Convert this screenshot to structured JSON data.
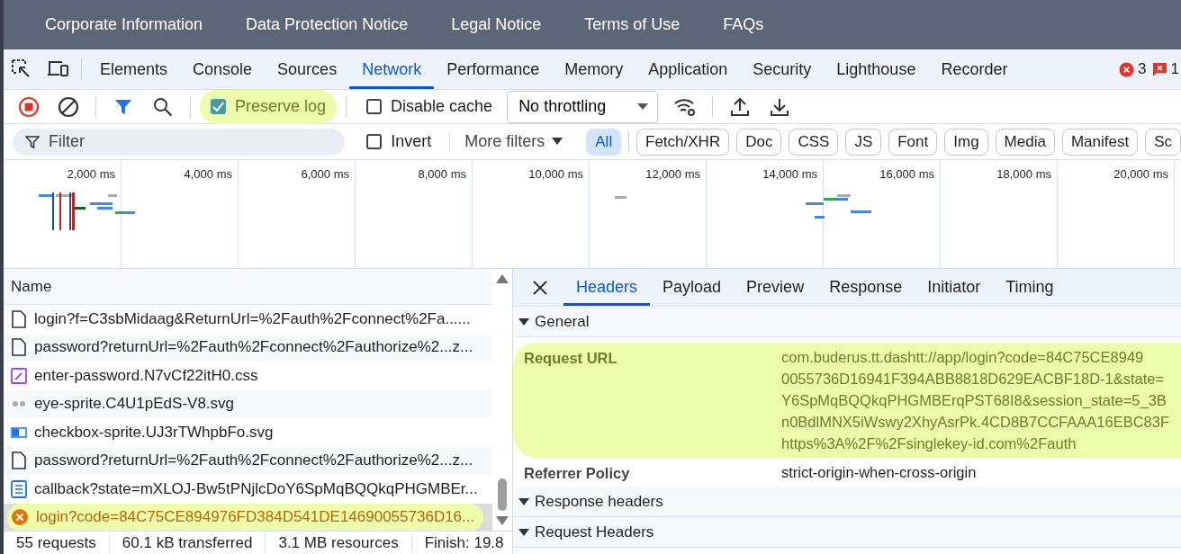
{
  "site_nav": [
    {
      "label": "Corporate Information"
    },
    {
      "label": "Data Protection Notice"
    },
    {
      "label": "Legal Notice"
    },
    {
      "label": "Terms of Use"
    },
    {
      "label": "FAQs"
    }
  ],
  "devtools_tabs": [
    {
      "label": "Elements",
      "selected": false
    },
    {
      "label": "Console",
      "selected": false
    },
    {
      "label": "Sources",
      "selected": false
    },
    {
      "label": "Network",
      "selected": true
    },
    {
      "label": "Performance",
      "selected": false
    },
    {
      "label": "Memory",
      "selected": false
    },
    {
      "label": "Application",
      "selected": false
    },
    {
      "label": "Security",
      "selected": false
    },
    {
      "label": "Lighthouse",
      "selected": false
    },
    {
      "label": "Recorder",
      "selected": false
    }
  ],
  "issue_counts": [
    {
      "kind": "error",
      "count": "3"
    },
    {
      "kind": "warning",
      "count": "1"
    }
  ],
  "toolbar": {
    "recording": true,
    "preserve_log": {
      "label": "Preserve log",
      "checked": true,
      "highlighted": true
    },
    "disable_cache": {
      "label": "Disable cache",
      "checked": false
    },
    "throttling": "No throttling"
  },
  "filter_bar": {
    "placeholder": "Filter",
    "invert": {
      "label": "Invert",
      "checked": false
    },
    "more_filters": "More filters",
    "chips": [
      {
        "label": "All",
        "selected": true
      },
      {
        "label": "Fetch/XHR",
        "selected": false
      },
      {
        "label": "Doc",
        "selected": false
      },
      {
        "label": "CSS",
        "selected": false
      },
      {
        "label": "JS",
        "selected": false
      },
      {
        "label": "Font",
        "selected": false
      },
      {
        "label": "Img",
        "selected": false
      },
      {
        "label": "Media",
        "selected": false
      },
      {
        "label": "Manifest",
        "selected": false
      },
      {
        "label": "Sc",
        "selected": false
      }
    ]
  },
  "timeline": {
    "ticks": [
      "2,000 ms",
      "4,000 ms",
      "6,000 ms",
      "8,000 ms",
      "10,000 ms",
      "12,000 ms",
      "14,000 ms",
      "16,000 ms",
      "18,000 ms",
      "20,000 ms"
    ]
  },
  "requests": {
    "column": "Name",
    "rows": [
      {
        "kind": "doc",
        "name": "login?f=C3sbMidaag&ReturnUrl=%2Fauth%2Fconnect%2Fa......",
        "selected": false,
        "highlighted": false
      },
      {
        "kind": "doc",
        "name": "password?returnUrl=%2Fauth%2Fconnect%2Fauthorize%2...z...",
        "selected": false,
        "highlighted": false
      },
      {
        "kind": "css",
        "name": "enter-password.N7vCf22itH0.css",
        "selected": false,
        "highlighted": false
      },
      {
        "kind": "sprite",
        "name": "eye-sprite.C4U1pEdS-V8.svg",
        "selected": false,
        "highlighted": false
      },
      {
        "kind": "image",
        "name": "checkbox-sprite.UJ3rTWhpbFo.svg",
        "selected": false,
        "highlighted": false
      },
      {
        "kind": "doc",
        "name": "password?returnUrl=%2Fauth%2Fconnect%2Fauthorize%2...z...",
        "selected": false,
        "highlighted": false
      },
      {
        "kind": "script",
        "name": "callback?state=mXLOJ-Bw5tPNjlcDoY6SpMqBQQkqPHGMBEr...",
        "selected": false,
        "highlighted": false
      },
      {
        "kind": "error",
        "name": "login?code=84C75CE894976FD384D541DE14690055736D16...",
        "selected": true,
        "highlighted": true
      }
    ]
  },
  "status_bar": [
    "55 requests",
    "60.1 kB transferred",
    "3.1 MB resources",
    "Finish: 19.8"
  ],
  "detail_tabs": [
    {
      "label": "Headers",
      "selected": true
    },
    {
      "label": "Payload",
      "selected": false
    },
    {
      "label": "Preview",
      "selected": false
    },
    {
      "label": "Response",
      "selected": false
    },
    {
      "label": "Initiator",
      "selected": false
    },
    {
      "label": "Timing",
      "selected": false
    }
  ],
  "sections": [
    {
      "title": "General",
      "expanded": true,
      "fields": [
        {
          "name": "Request URL",
          "highlighted": true,
          "value_lines": [
            "com.buderus.tt.dashtt://app/login?code=84C75CE8949",
            "0055736D16941F394ABB8818D629EACBF18D-1&state=",
            "Y6SpMqBQQkqPHGMBErqPST68I8&session_state=5_3B",
            "n0BdlMNX5iWswy2XhyAsrPk.4CD8B7CCFAAA16EBC83F",
            "https%3A%2F%2Fsinglekey-id.com%2Fauth"
          ]
        },
        {
          "name": "Referrer Policy",
          "highlighted": false,
          "value_lines": [
            "strict-origin-when-cross-origin"
          ]
        }
      ]
    },
    {
      "title": "Response headers",
      "expanded": true
    },
    {
      "title": "Request Headers",
      "expanded": true
    }
  ]
}
